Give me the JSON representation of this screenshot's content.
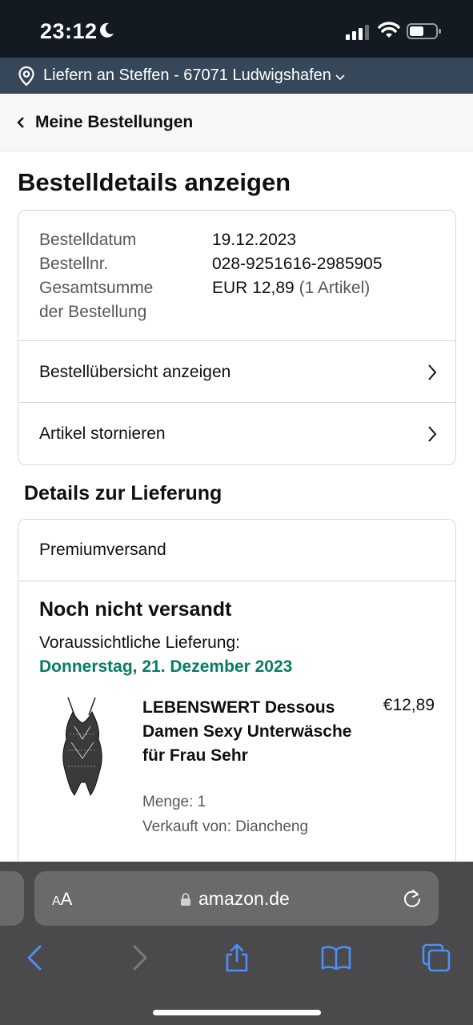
{
  "status": {
    "time": "23:12"
  },
  "location": {
    "text": "Liefern an Steffen - 67071 Ludwigshafen"
  },
  "nav": {
    "back_label": "Meine Bestellungen"
  },
  "page": {
    "title": "Bestelldetails anzeigen"
  },
  "order": {
    "date_label": "Bestelldatum",
    "date_value": "19.12.2023",
    "number_label": "Bestellnr.",
    "number_value": "028-9251616-2985905",
    "total_label_line1": "Gesamtsumme",
    "total_label_line2": "der Bestellung",
    "total_value": "EUR 12,89",
    "total_count": "(1 Artikel)",
    "link_overview": "Bestellübersicht anzeigen",
    "link_cancel": "Artikel stornieren"
  },
  "delivery": {
    "section_title": "Details zur Lieferung",
    "method": "Premiumversand",
    "status": "Noch nicht versandt",
    "eta_label": "Voraussichtliche Lieferung:",
    "eta_date": "Donnerstag, 21. Dezember 2023",
    "eta_color": "#067d62"
  },
  "product": {
    "title": "LEBENSWERT Dessous Damen Sexy Unterwäsche für Frau Sehr",
    "price": "€12,89",
    "quantity": "Menge: 1",
    "seller": "Verkauft von: Diancheng"
  },
  "browser": {
    "aa_small": "A",
    "aa_large": "A",
    "url": "amazon.de",
    "accent": "#4f8ef7"
  }
}
